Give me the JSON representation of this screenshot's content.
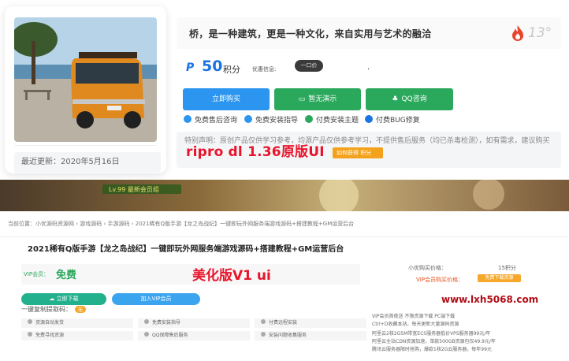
{
  "top": {
    "title": "桥，是一种建筑，更是一种文化，来自实用与艺术的融洽",
    "views": "13°",
    "updated": "最近更新：2020年5月16日",
    "price": "50",
    "price_unit": "积分",
    "discount_label": "优惠信息:",
    "discount_pill": "一口价",
    "dot": ".",
    "buttons": {
      "buy": "立即购买",
      "demo": "暂无演示",
      "qq": "QQ咨询"
    },
    "features": [
      "免费售后咨询",
      "免费安装指导",
      "付费安装主题",
      "付费BUG修复"
    ],
    "notice": "特别声明：原创产品仅供学习参考，均源产品仅供参考学习，不提供售后服务（均已杀毒检测），如有需求，建议购买",
    "get_button": "如何获得 积分",
    "overlay": "ripro dl 1.36原版UI",
    "colors": {
      "blue": "#2b95ef",
      "green": "#2aa85c",
      "red": "#e8142b"
    }
  },
  "bottom": {
    "banner_text": "Lv.99  最新会员组",
    "breadcrumb": "当前位置：小优源码资源网 › 游戏源码 › 手游源码 › 2021稀有Q版手游【龙之岛战纪】一键即玩外网服务端游戏源码+搭建教程+GM运营后台",
    "title": "2021稀有Q版手游【龙之岛战纪】一键即玩外网服务端游戏源码+搭建教程+GM运营后台",
    "vip_label": "VIP会员：",
    "free": "免费",
    "overlay": "美化版V1 ui",
    "right_label_1": "小优购买价格：",
    "right_value_1": "15积分",
    "right_vip_label": "VIP会员购买价格：",
    "right_vip_badge": "免费下载资源",
    "download_button": "立即下载",
    "vip_button": "加入VIP会员",
    "copy_label": "一键复制提取码：",
    "copy_badge": "无",
    "site": "www.lxh5068.com",
    "grid": [
      "资源自动发货",
      "免费安装指导",
      "付费远程安装",
      "免费寻找资源",
      "QQ保障售后服务",
      "安装问题收集服务"
    ],
    "right_texts": [
      "VIP会员首夜送 不限资源下载 PC端下载",
      "Ctrl+D收藏本站，每天更新大量源码资源",
      "阿里云2核2G5M带宽ECS服务器低价VPS服务器99元/年",
      "阿里云全站CDN资源加速，单款500GB资源包仅49.9元/年",
      "腾讯云服务器限时抢购，爆款1核2G云服务器，每年99元"
    ]
  }
}
